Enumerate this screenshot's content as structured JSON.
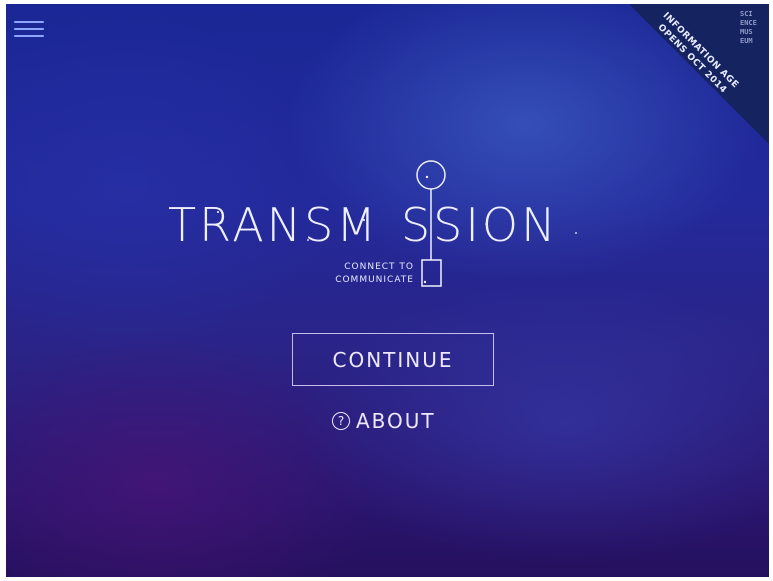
{
  "menu": {
    "icon": "hamburger-menu-icon"
  },
  "banner": {
    "line1": "INFORMATION AGE",
    "line2": "OPENS OCT 2014",
    "logo_icon": "science-museum-logo",
    "logo_letters": [
      "SCI",
      "ENCE",
      "MUS",
      "EUM"
    ],
    "color": "#16235e"
  },
  "logo": {
    "word_left": "TRANSM",
    "word_right": "SSION",
    "tagline_line1": "CONNECT TO",
    "tagline_line2": "COMMUNICATE"
  },
  "actions": {
    "continue_label": "CONTINUE",
    "about_label": "ABOUT",
    "about_icon": "question-circle-icon"
  },
  "colors": {
    "background_top": "#1b2796",
    "background_bottom": "#25105e",
    "text": "#eef0ff",
    "menu_icon": "#8fa6ff"
  }
}
